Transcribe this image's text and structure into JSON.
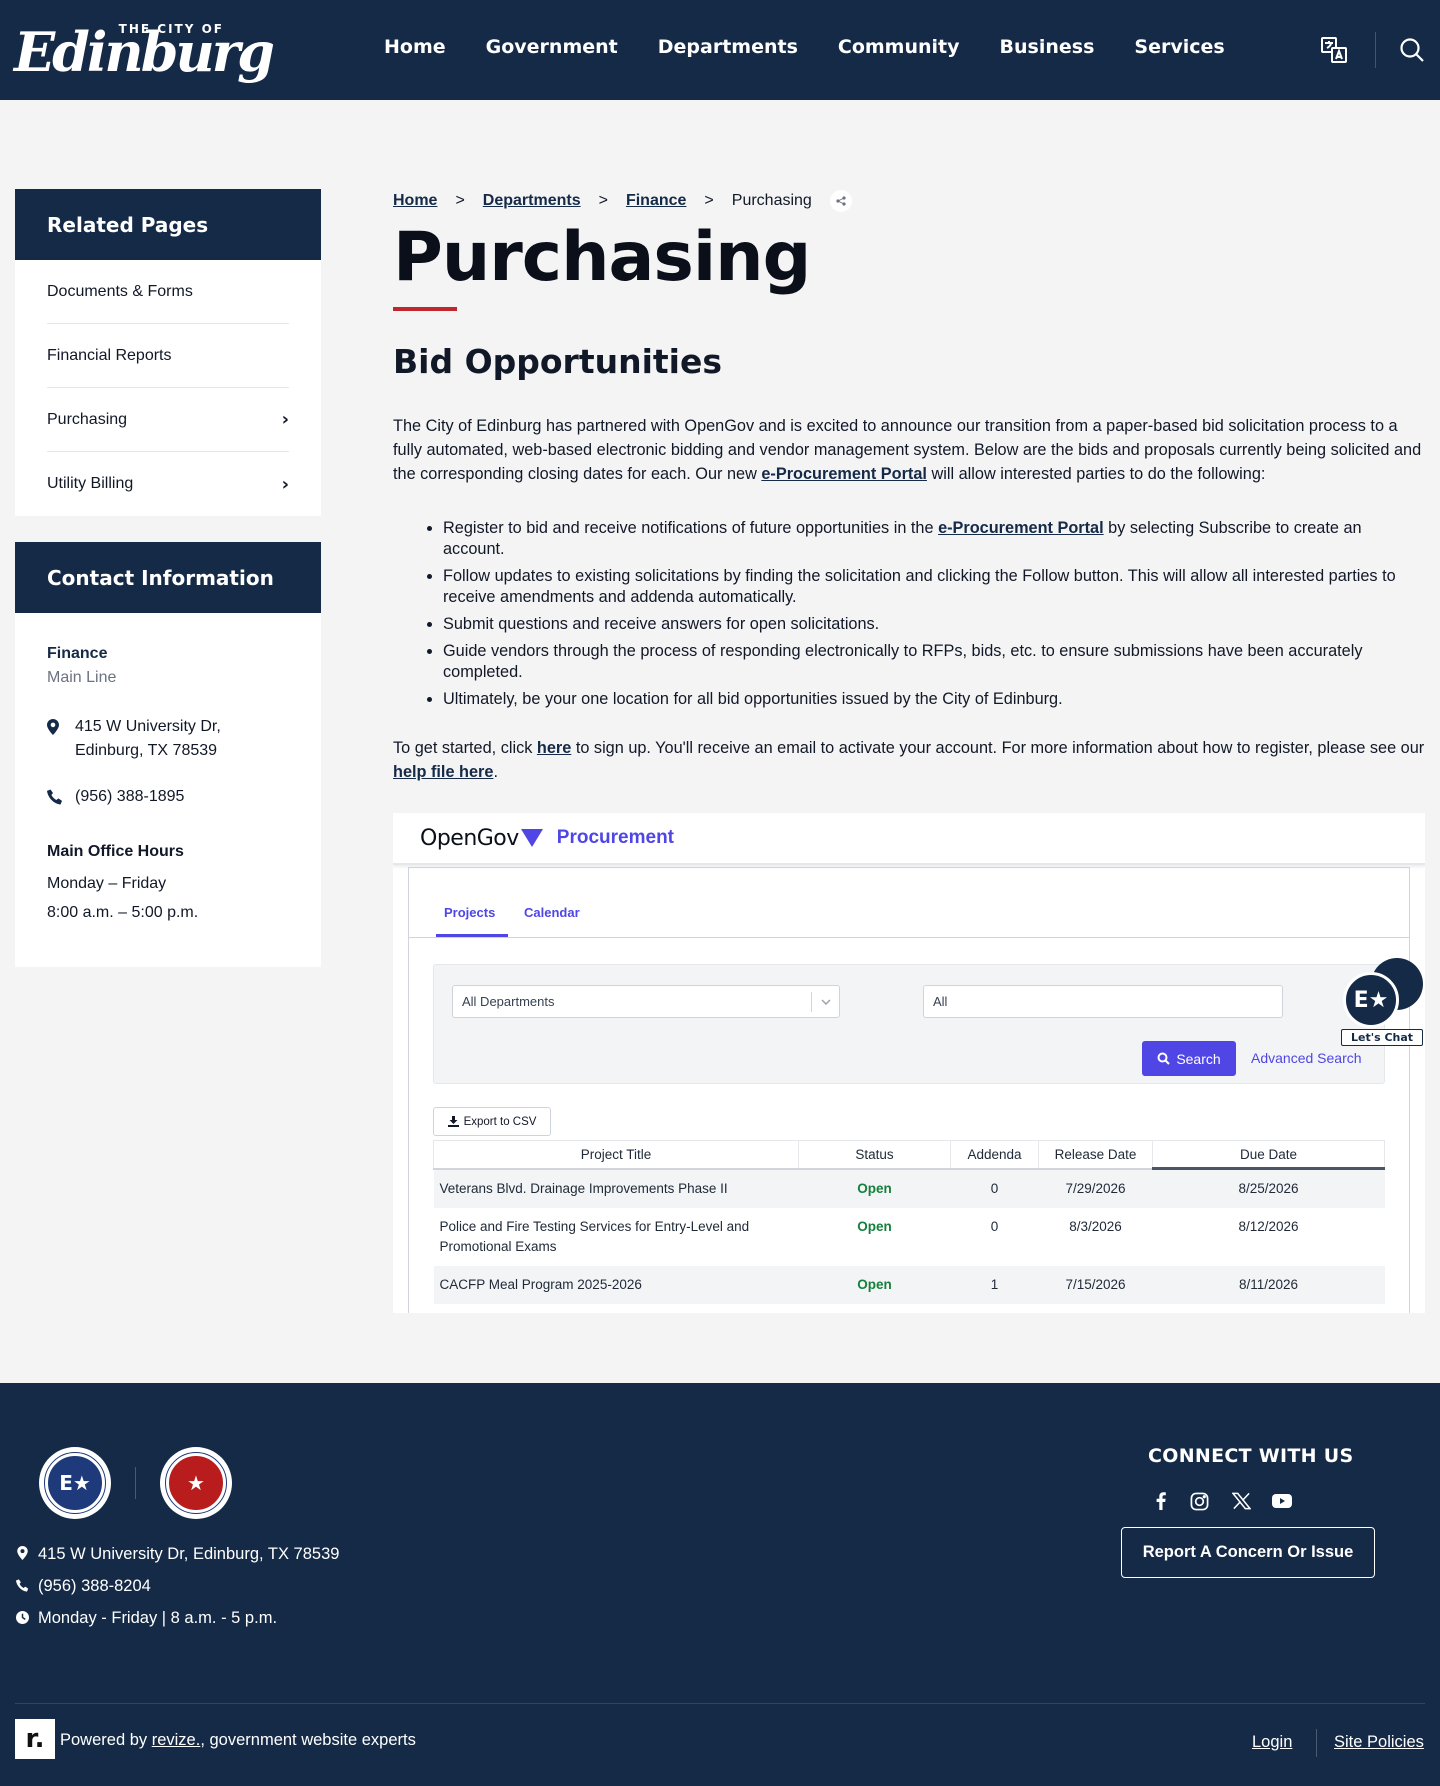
{
  "header": {
    "logo_small": "THE CITY OF",
    "logo_name": "Edinburg",
    "nav": [
      "Home",
      "Government",
      "Departments",
      "Community",
      "Business",
      "Services"
    ]
  },
  "sidebar": {
    "related_title": "Related Pages",
    "related_items": [
      {
        "label": "Documents & Forms",
        "chevron": ""
      },
      {
        "label": "Financial Reports",
        "chevron": ""
      },
      {
        "label": "Purchasing",
        "chevron": "›"
      },
      {
        "label": "Utility Billing",
        "chevron": "›"
      }
    ],
    "contact_title": "Contact Information",
    "department": "Finance",
    "line": "Main Line",
    "address_1": "415 W University Dr,",
    "address_2": "Edinburg, TX 78539",
    "phone": "(956) 388-1895",
    "hours_title": "Main Office Hours",
    "hours_days": "Monday – Friday",
    "hours_time": "8:00 a.m. – 5:00 p.m."
  },
  "breadcrumb": {
    "items": [
      "Home",
      "Departments",
      "Finance"
    ],
    "sep": ">",
    "current": "Purchasing"
  },
  "main": {
    "title": "Purchasing",
    "subtitle": "Bid Opportunities",
    "intro_1": "The City of Edinburg has partnered with OpenGov and is excited to announce our transition from a paper-based bid solicitation process to a fully automated, web-based electronic bidding and vendor management system. Below are the bids and proposals currently being solicited and the corresponding closing dates for each. Our new ",
    "intro_link": "e-Procurement Portal",
    "intro_2": " will allow interested parties to do the following:",
    "b1_pre": "Register to bid and receive notifications of future opportunities in the ",
    "b1_link": "e-Procurement Portal",
    "b1_post": " by selecting Subscribe to create an account.",
    "b2": "Follow updates to existing solicitations by finding the solicitation and clicking the Follow button. This will allow all interested parties to receive amendments and addenda automatically.",
    "b3": "Submit questions and receive answers for open solicitations.",
    "b4": "Guide vendors through the process of responding electronically to RFPs, bids, etc. to ensure submissions have been accurately completed.",
    "b5": "Ultimately, be your one location for all bid opportunities issued by the City of Edinburg.",
    "start_1": "To get started, click ",
    "start_link1": "here",
    "start_2": " to sign up. You'll receive an email to activate your account. For more information about how to register, please see our ",
    "start_link2": "help file here",
    "start_3": "."
  },
  "opengov": {
    "brand": "OpenGov",
    "product": "Procurement",
    "tabs": [
      "Projects",
      "Calendar"
    ],
    "dept_select": "All Departments",
    "status_select": "All",
    "search_label": "Search",
    "advanced_label": "Advanced Search",
    "chat_label": "Let's Chat",
    "export_label": "Export to CSV",
    "columns": [
      "Project Title",
      "Status",
      "Addenda",
      "Release Date",
      "Due Date"
    ],
    "rows": [
      {
        "title": "Veterans Blvd. Drainage Improvements Phase II",
        "status": "Open",
        "addenda": "0",
        "release": "7/29/2026",
        "due": "8/25/2026"
      },
      {
        "title": "Police and Fire Testing Services for Entry-Level and Promotional Exams",
        "status": "Open",
        "addenda": "0",
        "release": "8/3/2026",
        "due": "8/12/2026"
      },
      {
        "title": "CACFP Meal Program 2025-2026",
        "status": "Open",
        "addenda": "1",
        "release": "7/15/2026",
        "due": "8/11/2026"
      }
    ]
  },
  "footer": {
    "address": "415 W University Dr, Edinburg, TX 78539",
    "phone": "(956) 388-8204",
    "hours": "Monday - Friday | 8 a.m. - 5 p.m.",
    "connect": "CONNECT WITH US",
    "report": "Report A Concern Or Issue",
    "powered_pre": "Powered by ",
    "powered_link": "revize.",
    "powered_post": ", government website experts",
    "login": "Login",
    "policies": "Site Policies"
  },
  "colors": {
    "navy": "#152a47",
    "accent_red": "#c0262d",
    "opengov_purple": "#4f46e5",
    "open_green": "#15803d"
  }
}
